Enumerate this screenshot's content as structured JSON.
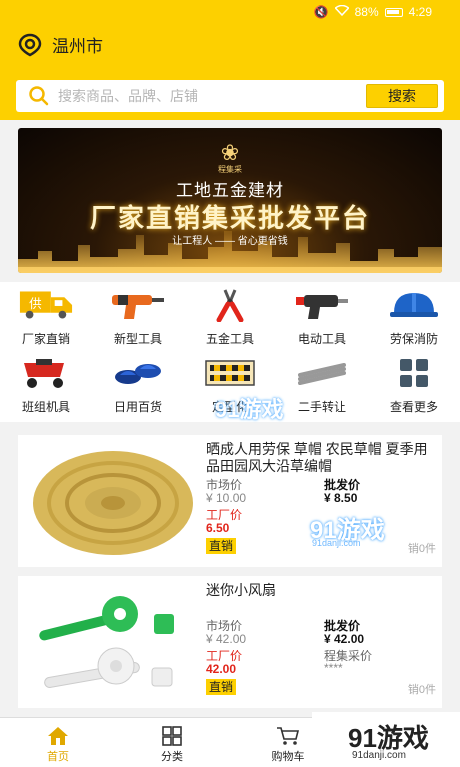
{
  "status_bar": {
    "battery": "88%",
    "time": "4:29"
  },
  "location": {
    "city": "温州市"
  },
  "search": {
    "placeholder": "搜索商品、品牌、店铺",
    "button": "搜索"
  },
  "banner": {
    "brand": "程集采",
    "subtitle": "工地五金建材",
    "title": "厂家直销集采批发平台",
    "tagline": "让工程人 —— 省心更省钱"
  },
  "categories": [
    {
      "label": "厂家直销",
      "icon": "truck-icon"
    },
    {
      "label": "新型工具",
      "icon": "drill-icon"
    },
    {
      "label": "五金工具",
      "icon": "pliers-icon"
    },
    {
      "label": "电动工具",
      "icon": "hammer-drill-icon"
    },
    {
      "label": "劳保消防",
      "icon": "helmet-icon"
    },
    {
      "label": "班组机具",
      "icon": "cart-icon"
    },
    {
      "label": "日用百货",
      "icon": "slippers-icon"
    },
    {
      "label": "定型化",
      "icon": "barrier-icon"
    },
    {
      "label": "二手转让",
      "icon": "pipes-icon"
    },
    {
      "label": "查看更多",
      "icon": "more-grid-icon"
    }
  ],
  "products": [
    {
      "name": "晒成人用劳保 草帽 农民草帽 夏季用品田园风大沿草编帽",
      "market_label": "市场价",
      "market_price": "¥ 10.00",
      "wholesale_label": "批发价",
      "wholesale_price": "¥ 8.50",
      "factory_label": "工厂价",
      "factory_price": "6.50",
      "tag": "直销",
      "sold": "销0件"
    },
    {
      "name": "迷你小风扇",
      "market_label": "市场价",
      "market_price": "¥ 42.00",
      "wholesale_label": "批发价",
      "wholesale_price": "¥ 42.00",
      "factory_label": "工厂价",
      "factory_price": "42.00",
      "group_label": "程集采价",
      "group_price": "****",
      "tag": "直销",
      "sold": "销0件"
    }
  ],
  "tabs": [
    {
      "label": "首页",
      "icon": "home-icon",
      "active": true
    },
    {
      "label": "分类",
      "icon": "category-icon",
      "active": false
    },
    {
      "label": "购物车",
      "icon": "cart-icon",
      "active": false
    }
  ],
  "watermark": {
    "brand": "91游戏",
    "url": "91danji.com"
  },
  "colors": {
    "accent": "#fdd000",
    "price_red": "#e1251b",
    "tab_active": "#e0a800"
  }
}
